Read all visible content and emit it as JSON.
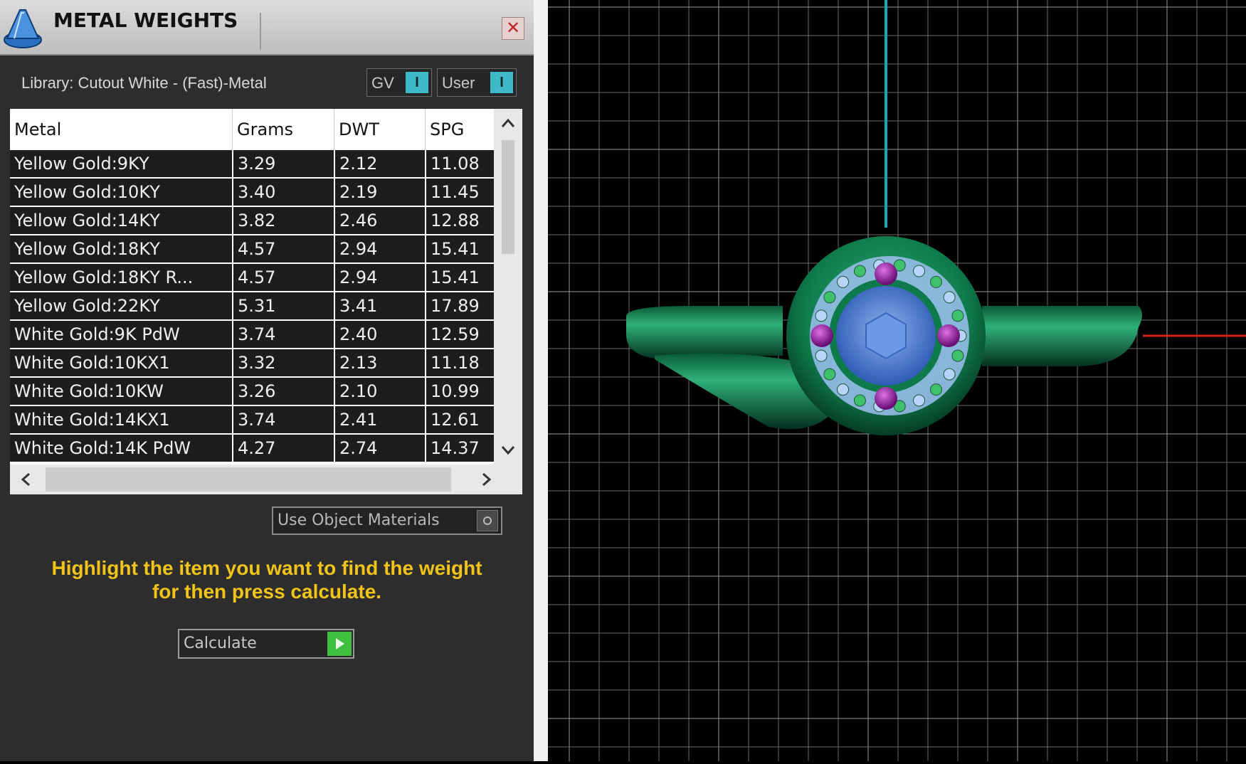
{
  "window": {
    "title": "METAL WEIGHTS",
    "close_glyph": "✕",
    "icon": "metal-weights-app-icon"
  },
  "library": {
    "label": "Library: Cutout White - (Fast)-Metal"
  },
  "toggles": {
    "gv": {
      "label": "GV",
      "state_glyph": "I"
    },
    "user": {
      "label": "User",
      "state_glyph": "I"
    }
  },
  "table": {
    "columns": [
      "Metal",
      "Grams",
      "DWT",
      "SPG"
    ],
    "rows": [
      [
        "Yellow Gold:9KY",
        "3.29",
        "2.12",
        "11.08"
      ],
      [
        "Yellow Gold:10KY",
        "3.40",
        "2.19",
        "11.45"
      ],
      [
        "Yellow Gold:14KY",
        "3.82",
        "2.46",
        "12.88"
      ],
      [
        "Yellow Gold:18KY",
        "4.57",
        "2.94",
        "15.41"
      ],
      [
        "Yellow Gold:18KY R...",
        "4.57",
        "2.94",
        "15.41"
      ],
      [
        "Yellow Gold:22KY",
        "5.31",
        "3.41",
        "17.89"
      ],
      [
        "White Gold:9K PdW",
        "3.74",
        "2.40",
        "12.59"
      ],
      [
        "White Gold:10KX1",
        "3.32",
        "2.13",
        "11.18"
      ],
      [
        "White Gold:10KW",
        "3.26",
        "2.10",
        "10.99"
      ],
      [
        "White Gold:14KX1",
        "3.74",
        "2.41",
        "12.61"
      ],
      [
        "White Gold:14K PdW",
        "4.27",
        "2.74",
        "14.37"
      ]
    ],
    "scroll": {
      "up": "^",
      "down": "v",
      "left": "<",
      "right": ">"
    }
  },
  "use_object_materials": {
    "label": "Use Object Materials"
  },
  "hint": {
    "line1": "Highlight the item you want to find the weight",
    "line2": "for then press calculate."
  },
  "calculate": {
    "label": "Calculate"
  },
  "viewport": {
    "axis_colors": {
      "y": "#1aa6b8",
      "x": "#d42020"
    },
    "ring_color": "#0e7a4c",
    "center_stone_color": "#5a86d8",
    "accent_stone_color": "#9a1fa0",
    "pave_stone_color": "#9ec0f0",
    "grid_color": "#6a6a6a"
  },
  "colors": {
    "panel_bg": "#2d2d2d",
    "hint_text": "#f0c419",
    "toggle_accent": "#3fb8c8",
    "calculate_go": "#3fbf3f"
  }
}
